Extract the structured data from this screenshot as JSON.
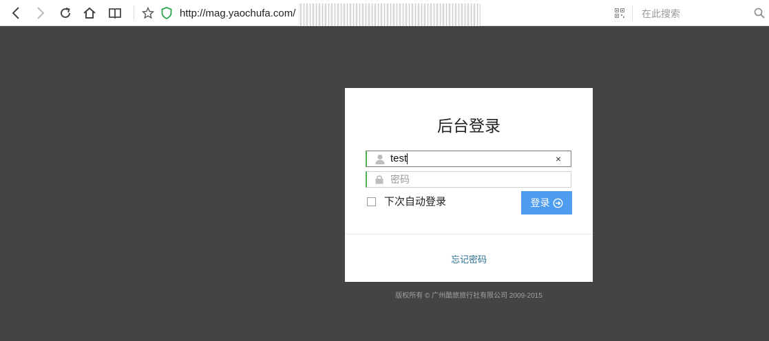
{
  "browser": {
    "url": "http://mag.yaochufa.com/",
    "search_placeholder": "在此搜索"
  },
  "login": {
    "title": "后台登录",
    "username_value": "test",
    "password_placeholder": "密码",
    "clear_glyph": "×",
    "remember_label": "下次自动登录",
    "remember_checked": false,
    "submit_label": "登录",
    "forgot_label": "忘记密码"
  },
  "footer": {
    "copyright": "版权所有 © 广州酷旅旅行社有限公司 2009-2015"
  },
  "colors": {
    "background": "#444444",
    "accent_button": "#4e9cf0",
    "field_focus_border": "#4caf50",
    "link": "#2a6d8f"
  },
  "icons": [
    "back-icon",
    "forward-icon",
    "reload-icon",
    "home-icon",
    "reader-icon",
    "star-icon",
    "shield-icon",
    "qrcode-icon",
    "search-icon",
    "user-icon",
    "lock-icon",
    "arrow-circle-icon"
  ]
}
